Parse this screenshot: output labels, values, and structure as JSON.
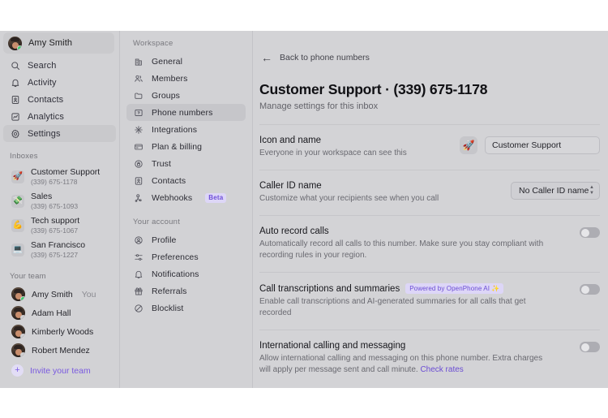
{
  "sidebar": {
    "user": {
      "name": "Amy Smith",
      "status": "online"
    },
    "nav": [
      {
        "label": "Search",
        "icon": "search-icon"
      },
      {
        "label": "Activity",
        "icon": "bell-icon"
      },
      {
        "label": "Contacts",
        "icon": "contacts-icon"
      },
      {
        "label": "Analytics",
        "icon": "analytics-icon"
      },
      {
        "label": "Settings",
        "icon": "gear-icon",
        "active": true
      }
    ],
    "inboxes_label": "Inboxes",
    "inboxes": [
      {
        "name": "Customer Support",
        "number": "(339) 675-1178",
        "emoji": "🚀"
      },
      {
        "name": "Sales",
        "number": "(339) 675-1093",
        "emoji": "💸"
      },
      {
        "name": "Tech support",
        "number": "(339) 675-1067",
        "emoji": "💪"
      },
      {
        "name": "San Francisco",
        "number": "(339) 675-1227",
        "emoji": "💻"
      }
    ],
    "team_label": "Your team",
    "team": [
      {
        "name": "Amy Smith",
        "suffix": "You",
        "status": "online"
      },
      {
        "name": "Adam Hall",
        "suffix": "",
        "status": "away"
      },
      {
        "name": "Kimberly Woods",
        "suffix": "",
        "status": "away"
      },
      {
        "name": "Robert Mendez",
        "suffix": "",
        "status": "away"
      }
    ],
    "invite_label": "Invite your team"
  },
  "settings_menu": {
    "workspace_label": "Workspace",
    "workspace": [
      {
        "label": "General",
        "icon": "building-icon"
      },
      {
        "label": "Members",
        "icon": "people-icon"
      },
      {
        "label": "Groups",
        "icon": "folder-icon"
      },
      {
        "label": "Phone numbers",
        "icon": "phone-number-icon",
        "active": true
      },
      {
        "label": "Integrations",
        "icon": "integrations-icon"
      },
      {
        "label": "Plan & billing",
        "icon": "card-icon"
      },
      {
        "label": "Trust",
        "icon": "shield-icon"
      },
      {
        "label": "Contacts",
        "icon": "contacts-icon"
      },
      {
        "label": "Webhooks",
        "icon": "webhooks-icon",
        "badge": "Beta"
      }
    ],
    "account_label": "Your account",
    "account": [
      {
        "label": "Profile",
        "icon": "profile-icon"
      },
      {
        "label": "Preferences",
        "icon": "sliders-icon"
      },
      {
        "label": "Notifications",
        "icon": "bell-icon"
      },
      {
        "label": "Referrals",
        "icon": "gift-icon"
      },
      {
        "label": "Blocklist",
        "icon": "block-icon"
      }
    ]
  },
  "main": {
    "back_label": "Back to phone numbers",
    "title": "Customer Support · (339) 675-1178",
    "subtitle": "Manage settings for this inbox",
    "rows": {
      "icon_and_name": {
        "title": "Icon and name",
        "desc": "Everyone in your workspace can see this",
        "emoji": "🚀",
        "input_value": "Customer Support"
      },
      "caller_id": {
        "title": "Caller ID name",
        "desc": "Customize what your recipients see when you call",
        "select_value": "No Caller ID name"
      },
      "auto_record": {
        "title": "Auto record calls",
        "desc": "Automatically record all calls to this number. Make sure you stay compliant with recording rules in your region.",
        "toggle": "off"
      },
      "transcriptions": {
        "title": "Call transcriptions and summaries",
        "badge": "Powered by OpenPhone AI ✨",
        "desc": "Enable call transcriptions and AI-generated summaries for all calls that get recorded",
        "toggle": "off"
      },
      "international": {
        "title": "International calling and messaging",
        "desc_part1": "Allow international calling and messaging on this phone number. Extra charges will apply per message sent and call minute.",
        "link": "Check rates",
        "toggle": "off"
      }
    }
  },
  "colors": {
    "accent": "#6b4dd4",
    "app_bg": "#d3d3d6",
    "sidebar_bg": "#d2d2d5",
    "online": "#3ecf6e"
  }
}
